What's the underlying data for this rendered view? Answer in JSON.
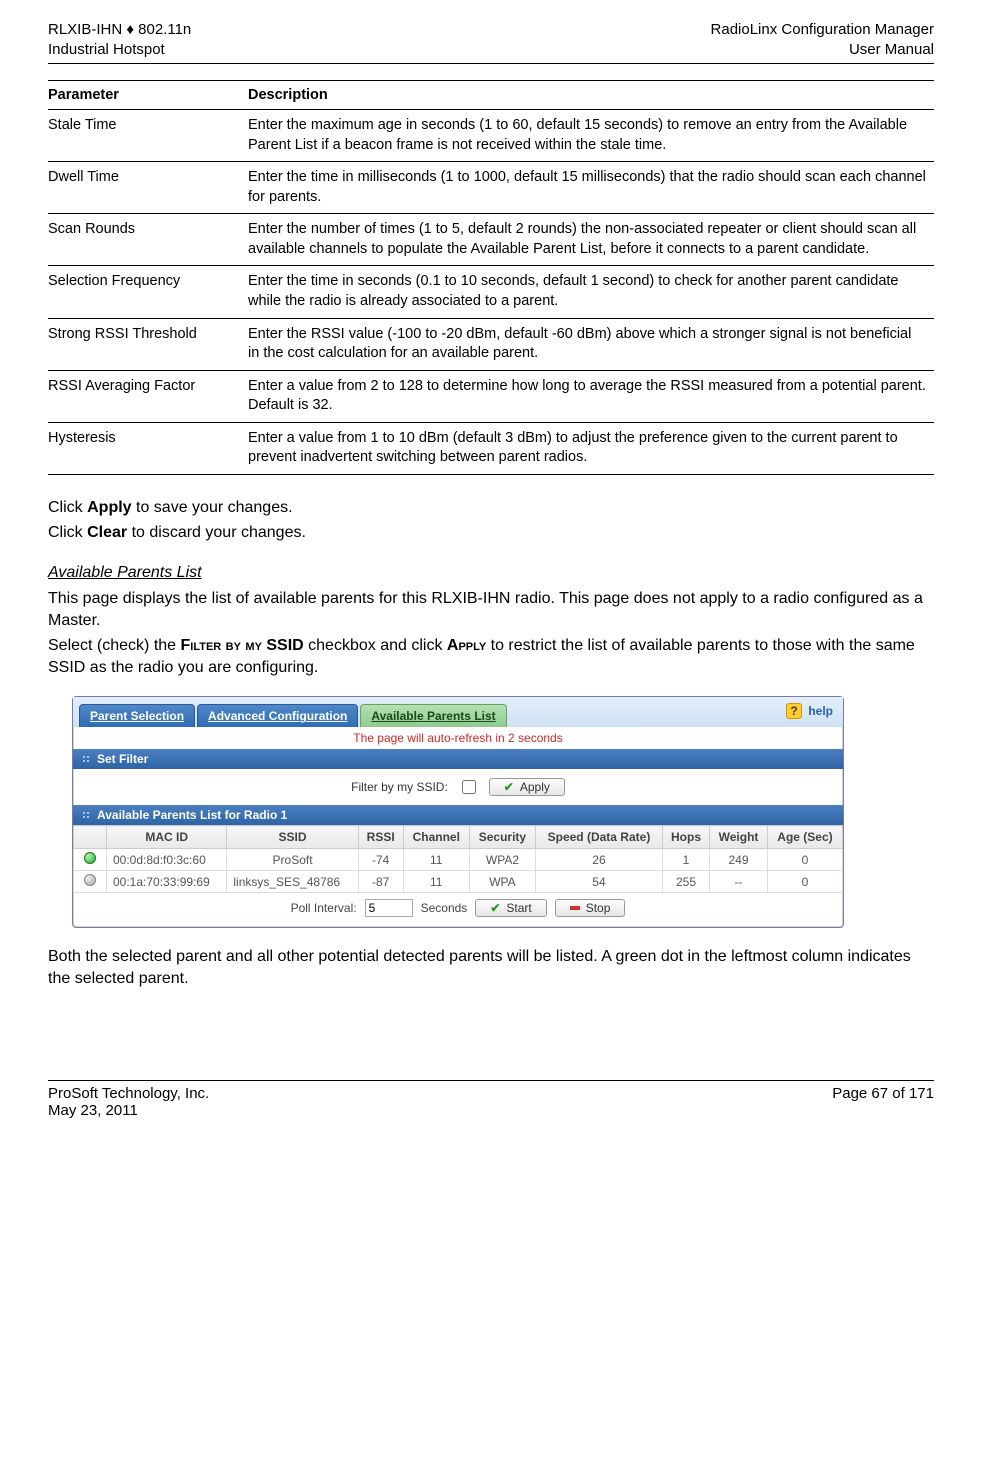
{
  "header": {
    "left_line1": "RLXIB-IHN ♦ 802.11n",
    "left_line2": "Industrial Hotspot",
    "right_line1": "RadioLinx Configuration Manager",
    "right_line2": "User Manual"
  },
  "param_table": {
    "head_parameter": "Parameter",
    "head_description": "Description",
    "rows": [
      {
        "param": "Stale Time",
        "desc": "Enter the maximum age in seconds (1 to 60, default 15 seconds) to remove an entry from the Available Parent List if a beacon frame is not received within the stale time."
      },
      {
        "param": "Dwell Time",
        "desc": "Enter the time in milliseconds (1 to 1000, default 15 milliseconds) that the radio should scan each channel for parents."
      },
      {
        "param": "Scan Rounds",
        "desc": "Enter the number of times (1 to 5, default 2 rounds) the non-associated repeater or client should scan all available channels to populate the Available Parent List, before it connects to a parent candidate."
      },
      {
        "param": "Selection Frequency",
        "desc": "Enter the time in seconds (0.1 to 10 seconds, default 1 second) to check for another parent candidate while the radio is already associated to a parent."
      },
      {
        "param": "Strong RSSI Threshold",
        "desc": "Enter the RSSI value (-100 to -20 dBm, default -60 dBm) above which a stronger signal is not beneficial in the cost calculation for an available parent."
      },
      {
        "param": "RSSI Averaging Factor",
        "desc": "Enter a value from 2 to 128 to determine how long to average the RSSI measured from a potential parent. Default is 32."
      },
      {
        "param": "Hysteresis",
        "desc": "Enter a value from 1 to 10 dBm (default 3 dBm) to adjust the preference given to the current parent to prevent inadvertent switching between parent radios."
      }
    ]
  },
  "body": {
    "click_apply_pre": "Click ",
    "click_apply_bold": "Apply",
    "click_apply_post": " to save your changes.",
    "click_clear_pre": "Click ",
    "click_clear_bold": "Clear",
    "click_clear_post": " to discard your changes.",
    "section_heading": "Available Parents List",
    "para1": "This page displays the list of available parents for this RLXIB-IHN radio. This page does not apply to a radio configured as a Master.",
    "para2_pre": "Select (check) the ",
    "para2_sc1": "Filter by my SSID",
    "para2_mid": " checkbox and click ",
    "para2_sc2": "Apply",
    "para2_post": " to restrict the list of available parents to those with the same SSID as the radio you are configuring.",
    "closing": "Both the selected parent and all other potential detected parents will be listed. A green dot in the leftmost column indicates the selected parent."
  },
  "screenshot": {
    "tabs": {
      "parent_selection": "Parent Selection",
      "advanced_config": "Advanced Configuration",
      "available_parents": "Available Parents List"
    },
    "help_label": "help",
    "refresh_msg": "The page will auto-refresh in 2 seconds",
    "bar_set_filter": "Set Filter",
    "filter_label": "Filter by my SSID:",
    "apply_btn": "Apply",
    "bar_list_title": "Available Parents List for Radio 1",
    "columns": {
      "mac": "MAC ID",
      "ssid": "SSID",
      "rssi": "RSSI",
      "channel": "Channel",
      "security": "Security",
      "speed": "Speed (Data Rate)",
      "hops": "Hops",
      "weight": "Weight",
      "age": "Age (Sec)"
    },
    "rows": [
      {
        "dot": "green",
        "mac": "00:0d:8d:f0:3c:60",
        "ssid": "ProSoft",
        "rssi": "-74",
        "channel": "11",
        "security": "WPA2",
        "speed": "26",
        "hops": "1",
        "weight": "249",
        "age": "0"
      },
      {
        "dot": "gray",
        "mac": "00:1a:70:33:99:69",
        "ssid": "linksys_SES_48786",
        "rssi": "-87",
        "channel": "11",
        "security": "WPA",
        "speed": "54",
        "hops": "255",
        "weight": "--",
        "age": "0"
      }
    ],
    "footer": {
      "poll_label": "Poll Interval:",
      "poll_value": "5",
      "seconds_label": "Seconds",
      "start_btn": "Start",
      "stop_btn": "Stop"
    }
  },
  "footer": {
    "left_line1": "ProSoft Technology, Inc.",
    "left_line2": "May 23, 2011",
    "right": "Page 67 of 171"
  }
}
